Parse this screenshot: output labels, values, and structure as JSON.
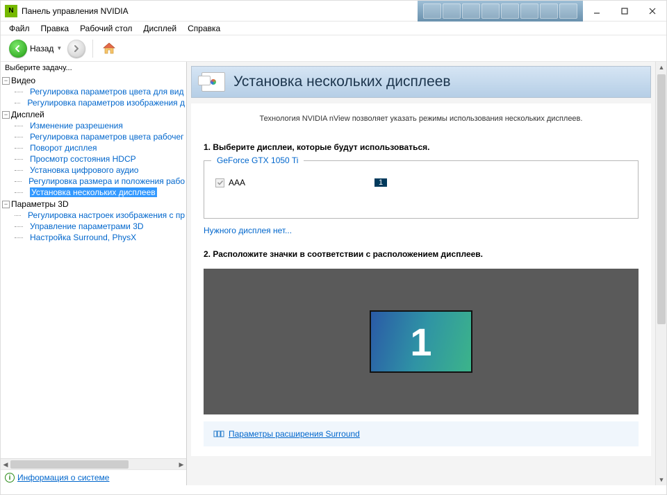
{
  "window": {
    "title": "Панель управления NVIDIA"
  },
  "menu": [
    "Файл",
    "Правка",
    "Рабочий стол",
    "Дисплей",
    "Справка"
  ],
  "nav": {
    "back": "Назад"
  },
  "sidebar": {
    "header": "Выберите задачу...",
    "footer": "Информация о системе",
    "tree": [
      {
        "label": "Видео",
        "children": [
          "Регулировка параметров цвета для вид",
          "Регулировка параметров изображения д"
        ]
      },
      {
        "label": "Дисплей",
        "children": [
          "Изменение разрешения",
          "Регулировка параметров цвета рабочег",
          "Поворот дисплея",
          "Просмотр состояния HDCP",
          "Установка цифрового аудио",
          "Регулировка размера и положения рабо",
          "Установка нескольких дисплеев"
        ],
        "activeIndex": 6
      },
      {
        "label": "Параметры 3D",
        "children": [
          "Регулировка настроек изображения с пр",
          "Управление параметрами 3D",
          "Настройка Surround, PhysX"
        ]
      }
    ]
  },
  "content": {
    "title": "Установка нескольких дисплеев",
    "description": "Технология NVIDIA nView позволяет указать режимы использования нескольких дисплеев.",
    "step1": "1. Выберите дисплеи, которые будут использоваться.",
    "gpu": "GeForce GTX 1050 Ti",
    "display_name": "AAA",
    "display_id": "1",
    "missing_link": "Нужного дисплея нет...",
    "step2": "2. Расположите значки в соответствии с расположением дисплеев.",
    "monitor_number": "1",
    "surround_link": "Параметры расширения Surround"
  }
}
